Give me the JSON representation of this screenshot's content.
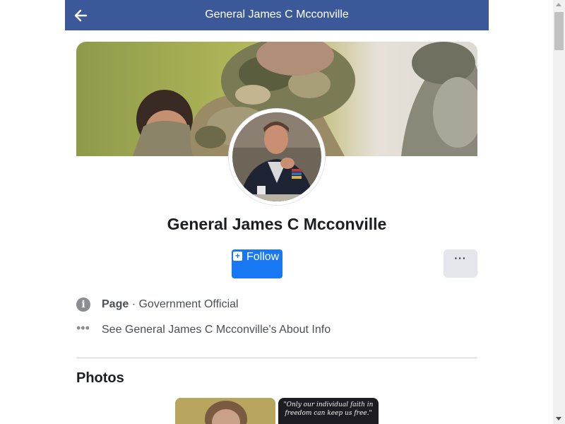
{
  "header": {
    "title": "General James C Mcconville",
    "back_icon": "arrow-left-icon"
  },
  "profile": {
    "name": "General James C Mcconville",
    "follow_label": "Follow",
    "more_label": "···"
  },
  "info": {
    "page_label": "Page",
    "separator": "·",
    "category": "Government Official",
    "about_link": "See General James C Mcconville's About Info"
  },
  "photos": {
    "heading": "Photos",
    "quote_line1": "\"Only our individual faith in",
    "quote_line2": "freedom can keep us free.\""
  },
  "colors": {
    "header_bg": "#3b5998",
    "primary_button": "#1877f2",
    "secondary_button": "#e4e6eb",
    "text": "#1c1e21",
    "muted": "#4b4f56"
  }
}
